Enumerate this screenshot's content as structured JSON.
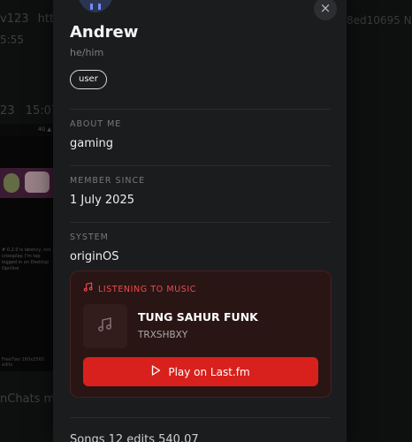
{
  "background": {
    "line1_user": "v123",
    "line1_rest": "https",
    "line1_right": "8ed10695 Nic",
    "line2": "5:55",
    "line3_user": "23",
    "line3_time": "15:07",
    "line4": "nChats mo",
    "phone_text": "# 0.2.0 is latency, not crossplay. I'm tap logged in on Desktop Opnline",
    "phone_foot": "FreeTian   160x2560 edits",
    "status_bar": "4G ▲"
  },
  "profile": {
    "name": "Andrew",
    "pronouns": "he/him",
    "role": "user",
    "about_label": "ABOUT ME",
    "about_value": "gaming",
    "member_label": "MEMBER SINCE",
    "member_value": "1 July 2025",
    "system_label": "SYSTEM",
    "system_value": "originOS"
  },
  "music": {
    "heading": "LISTENING TO MUSIC",
    "track": "TUNG SAHUR FUNK",
    "artist": "TRXSHBXY",
    "button": "Play on Last.fm"
  },
  "close_symbol": "×",
  "bottom_peek": "Songs   12 edits   540.07",
  "colors": {
    "accent_red": "#d8211c",
    "label_red": "#ef4b4b",
    "panel": "#1b1c1e"
  },
  "icons": [
    "close-icon",
    "music-note-icon",
    "album-art-icon",
    "play-icon"
  ]
}
